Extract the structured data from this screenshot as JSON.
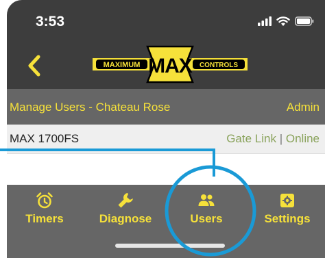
{
  "status_bar": {
    "time": "3:53",
    "icons": [
      "cellular-signal-icon",
      "wifi-icon",
      "battery-icon"
    ]
  },
  "nav": {
    "back_icon": "chevron-left-icon",
    "logo": {
      "left_text": "MAXIMUM",
      "center_text": "MAX",
      "right_text": "CONTROLS",
      "colors": {
        "yellow": "#f6e13a",
        "black": "#000000"
      }
    }
  },
  "users_header": {
    "title": "Manage Users - Chateau Rose",
    "role": "Admin"
  },
  "device": {
    "name": "MAX 1700FS",
    "link_label": "Gate Link",
    "separator": "|",
    "status": "Online"
  },
  "tabs": [
    {
      "label": "Timers",
      "icon": "alarm-clock-icon"
    },
    {
      "label": "Diagnose",
      "icon": "wrench-icon"
    },
    {
      "label": "Users",
      "icon": "users-icon"
    },
    {
      "label": "Settings",
      "icon": "gear-icon"
    }
  ],
  "theme": {
    "dark_bar": "#3d3d3d",
    "mid_gray": "#666666",
    "accent_yellow": "#f6e13a",
    "online_green": "#8aa35c",
    "highlight_blue": "#1a9ad6"
  }
}
